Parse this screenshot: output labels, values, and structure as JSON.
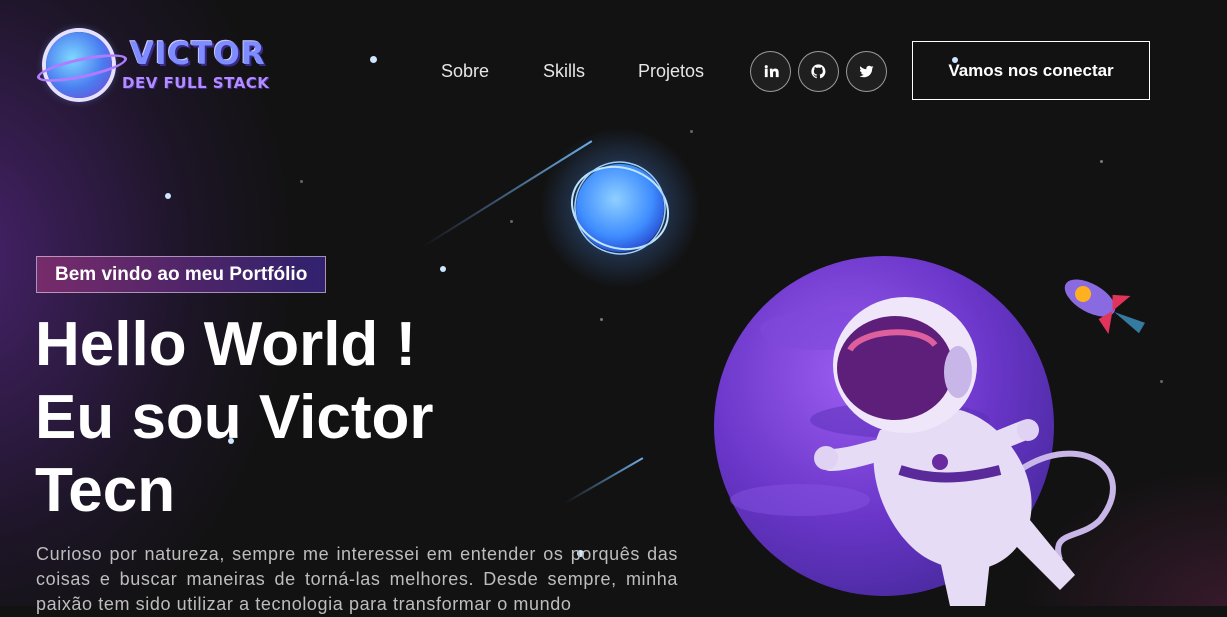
{
  "brand": {
    "title": "VICTOR",
    "subtitle": "DEV FULL STACK"
  },
  "nav": {
    "links": [
      "Sobre",
      "Skills",
      "Projetos"
    ],
    "social": [
      "linkedin-icon",
      "github-icon",
      "twitter-icon"
    ],
    "cta_label": "Vamos nos conectar"
  },
  "hero": {
    "tagline": "Bem vindo ao meu Portfólio",
    "title_lines": [
      "Hello World !",
      "Eu sou Victor",
      "Tecn"
    ],
    "description": "Curioso por natureza, sempre me interessei em entender os porquês das coisas e buscar maneiras de torná-las melhores. Desde sempre, minha paixão tem sido utilizar a tecnologia para transformar o mundo"
  },
  "colors": {
    "background": "#121212",
    "accent_purple": "#7a3fc8",
    "accent_blue": "#4a7cf0",
    "tagline_gradient_start": "#aa367c",
    "tagline_gradient_end": "#4a2fbd"
  }
}
